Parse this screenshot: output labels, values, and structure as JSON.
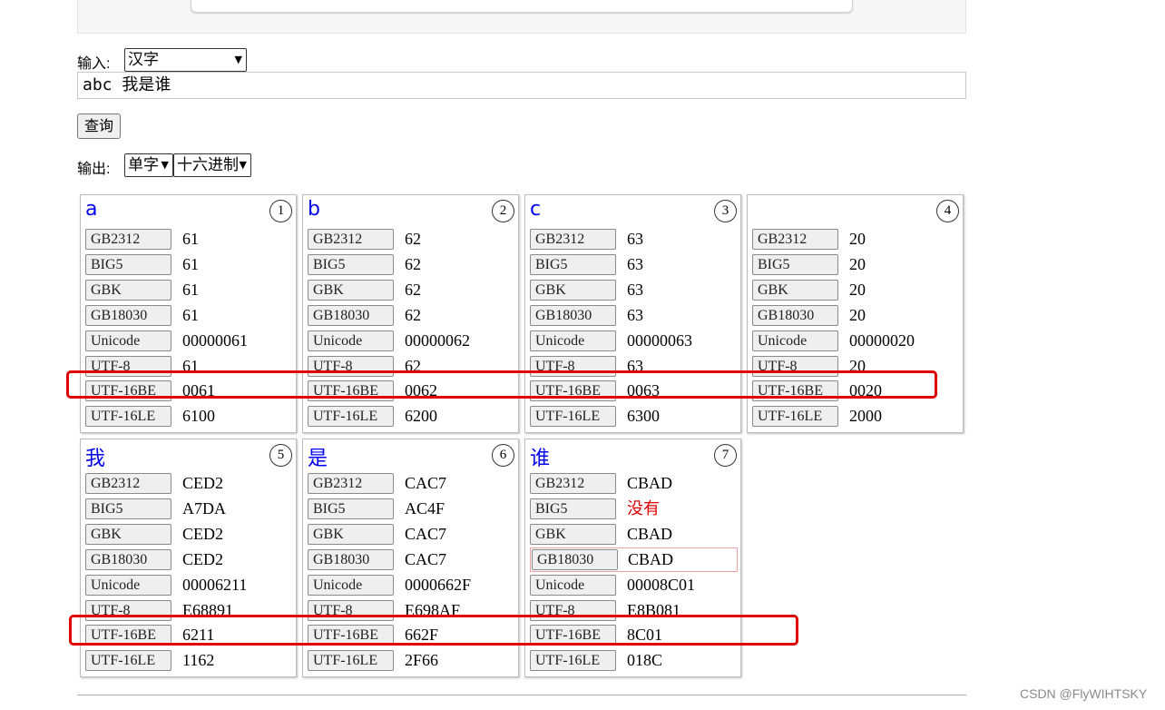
{
  "input": {
    "label": "输入:",
    "mode_selected": "汉字",
    "text_value": "abc 我是谁"
  },
  "query_button": "查询",
  "output": {
    "label": "输出:",
    "split_selected": "单字",
    "format_selected": "十六进制"
  },
  "cards": [
    {
      "char": "a",
      "index": "1",
      "rows": [
        {
          "encoding": "GB2312",
          "value": "61"
        },
        {
          "encoding": "BIG5",
          "value": "61"
        },
        {
          "encoding": "GBK",
          "value": "61"
        },
        {
          "encoding": "GB18030",
          "value": "61"
        },
        {
          "encoding": "Unicode",
          "value": "00000061"
        },
        {
          "encoding": "UTF-8",
          "value": "61"
        },
        {
          "encoding": "UTF-16BE",
          "value": "0061"
        },
        {
          "encoding": "UTF-16LE",
          "value": "6100"
        }
      ]
    },
    {
      "char": "b",
      "index": "2",
      "rows": [
        {
          "encoding": "GB2312",
          "value": "62"
        },
        {
          "encoding": "BIG5",
          "value": "62"
        },
        {
          "encoding": "GBK",
          "value": "62"
        },
        {
          "encoding": "GB18030",
          "value": "62"
        },
        {
          "encoding": "Unicode",
          "value": "00000062"
        },
        {
          "encoding": "UTF-8",
          "value": "62"
        },
        {
          "encoding": "UTF-16BE",
          "value": "0062"
        },
        {
          "encoding": "UTF-16LE",
          "value": "6200"
        }
      ]
    },
    {
      "char": "c",
      "index": "3",
      "rows": [
        {
          "encoding": "GB2312",
          "value": "63"
        },
        {
          "encoding": "BIG5",
          "value": "63"
        },
        {
          "encoding": "GBK",
          "value": "63"
        },
        {
          "encoding": "GB18030",
          "value": "63"
        },
        {
          "encoding": "Unicode",
          "value": "00000063"
        },
        {
          "encoding": "UTF-8",
          "value": "63"
        },
        {
          "encoding": "UTF-16BE",
          "value": "0063"
        },
        {
          "encoding": "UTF-16LE",
          "value": "6300"
        }
      ]
    },
    {
      "char": "",
      "index": "4",
      "rows": [
        {
          "encoding": "GB2312",
          "value": "20"
        },
        {
          "encoding": "BIG5",
          "value": "20"
        },
        {
          "encoding": "GBK",
          "value": "20"
        },
        {
          "encoding": "GB18030",
          "value": "20"
        },
        {
          "encoding": "Unicode",
          "value": "00000020"
        },
        {
          "encoding": "UTF-8",
          "value": "20"
        },
        {
          "encoding": "UTF-16BE",
          "value": "0020"
        },
        {
          "encoding": "UTF-16LE",
          "value": "2000"
        }
      ]
    },
    {
      "char": "我",
      "index": "5",
      "rows": [
        {
          "encoding": "GB2312",
          "value": "CED2"
        },
        {
          "encoding": "BIG5",
          "value": "A7DA"
        },
        {
          "encoding": "GBK",
          "value": "CED2"
        },
        {
          "encoding": "GB18030",
          "value": "CED2"
        },
        {
          "encoding": "Unicode",
          "value": "00006211"
        },
        {
          "encoding": "UTF-8",
          "value": "E68891"
        },
        {
          "encoding": "UTF-16BE",
          "value": "6211"
        },
        {
          "encoding": "UTF-16LE",
          "value": "1162"
        }
      ]
    },
    {
      "char": "是",
      "index": "6",
      "rows": [
        {
          "encoding": "GB2312",
          "value": "CAC7"
        },
        {
          "encoding": "BIG5",
          "value": "AC4F"
        },
        {
          "encoding": "GBK",
          "value": "CAC7"
        },
        {
          "encoding": "GB18030",
          "value": "CAC7"
        },
        {
          "encoding": "Unicode",
          "value": "0000662F"
        },
        {
          "encoding": "UTF-8",
          "value": "E698AF"
        },
        {
          "encoding": "UTF-16BE",
          "value": "662F"
        },
        {
          "encoding": "UTF-16LE",
          "value": "2F66"
        }
      ]
    },
    {
      "char": "谁",
      "index": "7",
      "rows": [
        {
          "encoding": "GB2312",
          "value": "CBAD"
        },
        {
          "encoding": "BIG5",
          "value": "没有",
          "missing": true
        },
        {
          "encoding": "GBK",
          "value": "CBAD"
        },
        {
          "encoding": "GB18030",
          "value": "CBAD",
          "focused": true
        },
        {
          "encoding": "Unicode",
          "value": "00008C01"
        },
        {
          "encoding": "UTF-8",
          "value": "E8B081"
        },
        {
          "encoding": "UTF-16BE",
          "value": "8C01"
        },
        {
          "encoding": "UTF-16LE",
          "value": "018C"
        }
      ]
    }
  ],
  "colors": {
    "highlight": "#e10000",
    "char_link": "#0000ee",
    "missing": "#e00000"
  },
  "watermark": "CSDN @FlyWIHTSKY"
}
